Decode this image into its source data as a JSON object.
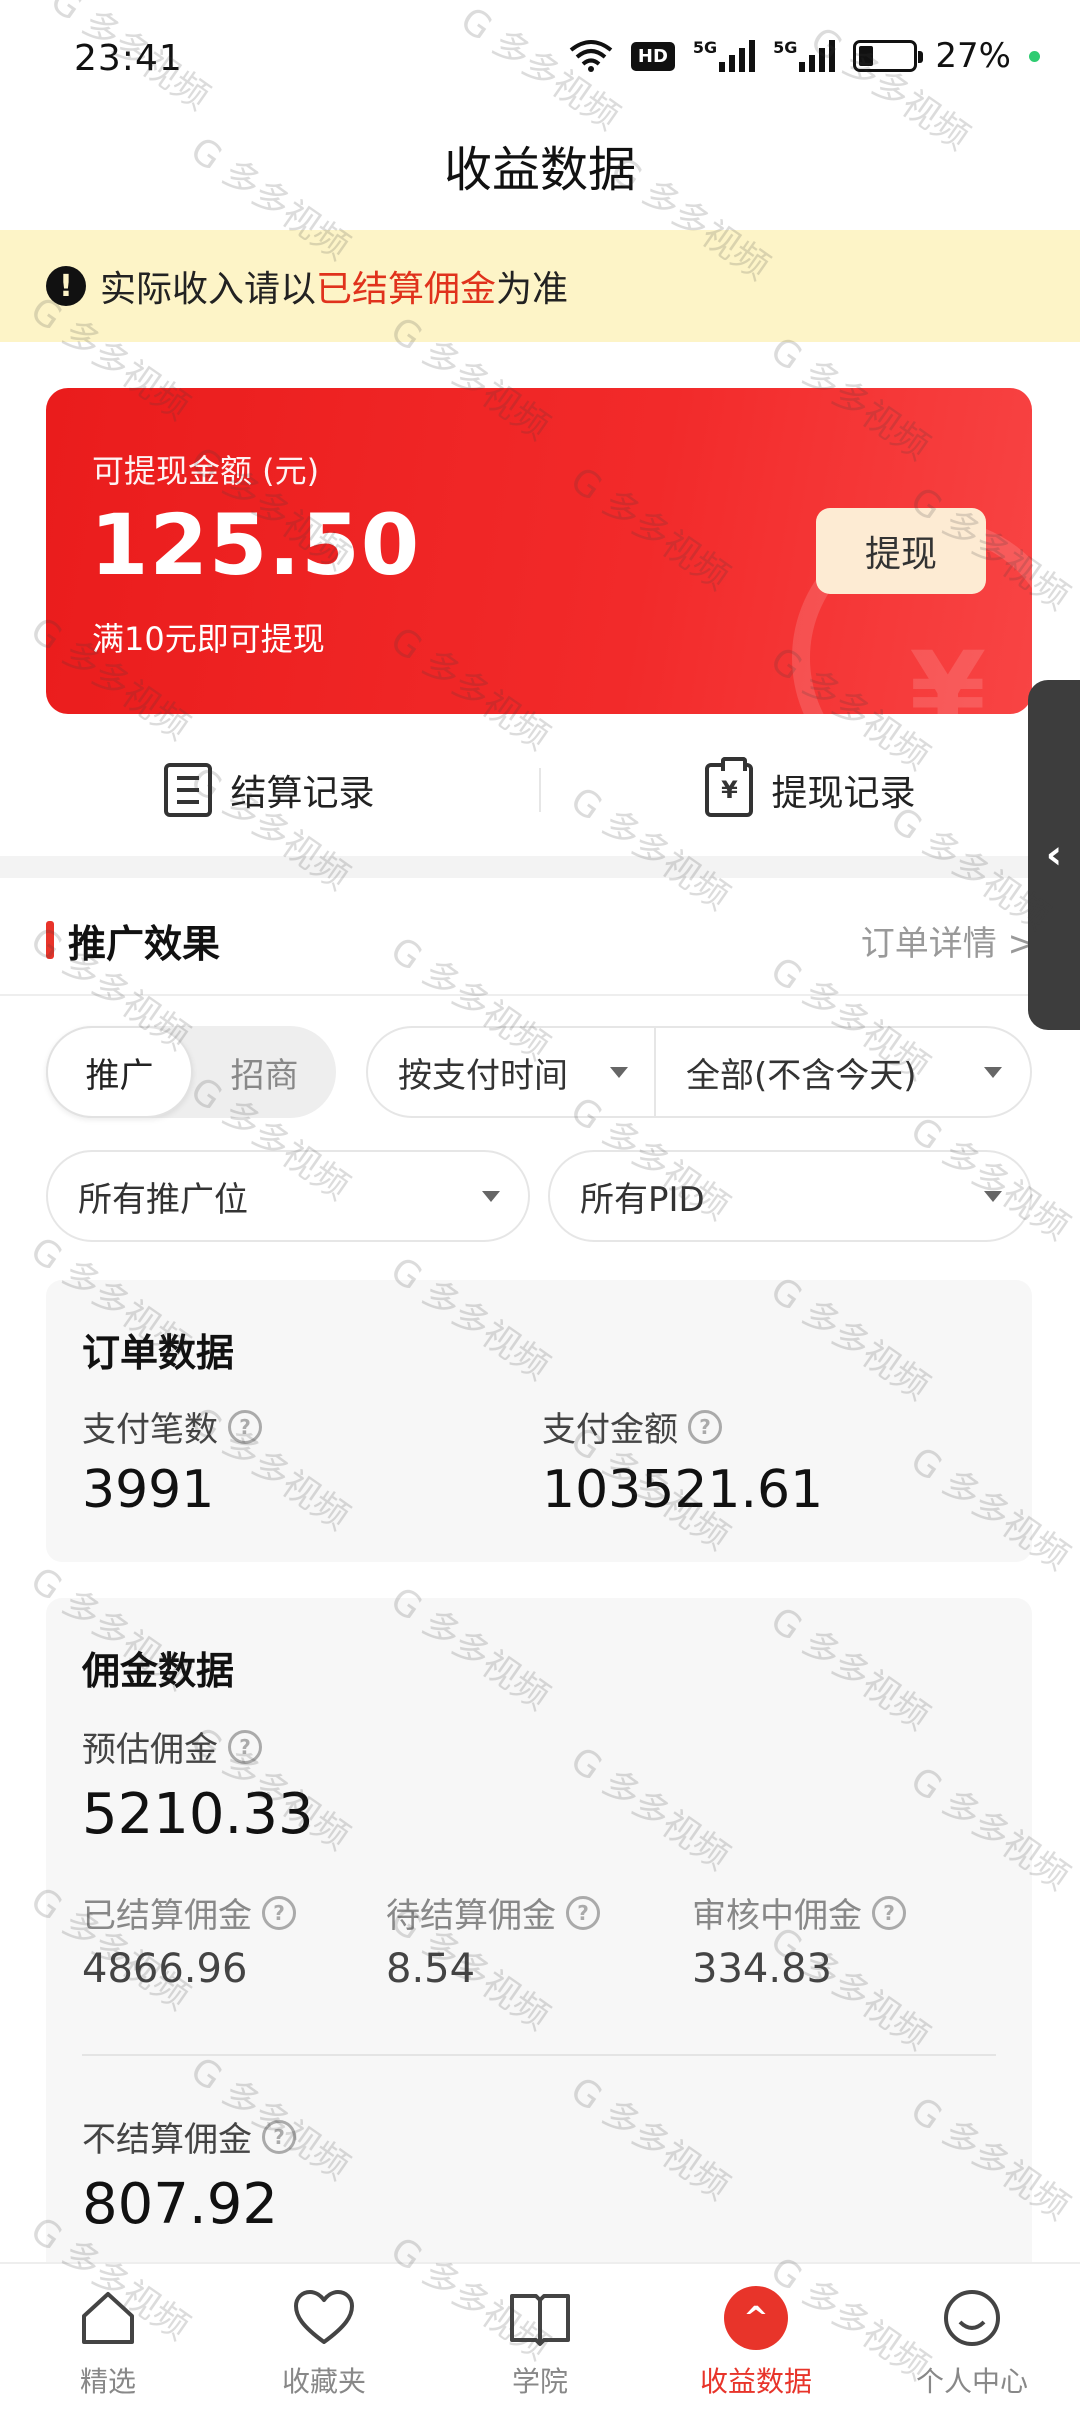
{
  "status_bar": {
    "time": "23:41",
    "hd_label": "HD",
    "net1": "5G",
    "net2": "5G",
    "battery_percent_text": "27%",
    "battery_level": 0.27
  },
  "page_title": "收益数据",
  "notice": {
    "prefix": "实际收入请以",
    "highlight": "已结算佣金",
    "suffix": "为准",
    "highlight_color": "#e0321c"
  },
  "balance_card": {
    "label": "可提现金额 (元)",
    "amount": "125.50",
    "tip": "满10元即可提现",
    "withdraw_label": "提现",
    "card_color": "#ef2424"
  },
  "records": {
    "settle_label": "结算记录",
    "withdraw_label": "提现记录"
  },
  "section": {
    "title": "推广效果",
    "link": "订单详情 >",
    "accent_color": "#e8342a"
  },
  "filters": {
    "segments": [
      "推广",
      "招商"
    ],
    "active_segment": "推广",
    "time_type": "按支付时间",
    "range": "全部(不含今天)",
    "position": "所有推广位",
    "pid": "所有PID"
  },
  "order_data": {
    "title": "订单数据",
    "pay_count_label": "支付笔数",
    "pay_count": "3991",
    "pay_amount_label": "支付金额",
    "pay_amount": "103521.61"
  },
  "commission_data": {
    "title": "佣金数据",
    "estimated_label": "预估佣金",
    "estimated": "5210.33",
    "settled_label": "已结算佣金",
    "settled": "4866.96",
    "pending_label": "待结算佣金",
    "pending": "8.54",
    "reviewing_label": "审核中佣金",
    "reviewing": "334.83",
    "not_settle_label": "不结算佣金",
    "not_settle": "807.92"
  },
  "bottom_nav": {
    "items": [
      "精选",
      "收藏夹",
      "学院",
      "收益数据",
      "个人中心"
    ],
    "active": "收益数据"
  },
  "side_tab_glyph": "‹",
  "watermark_text": "G 多多视频"
}
